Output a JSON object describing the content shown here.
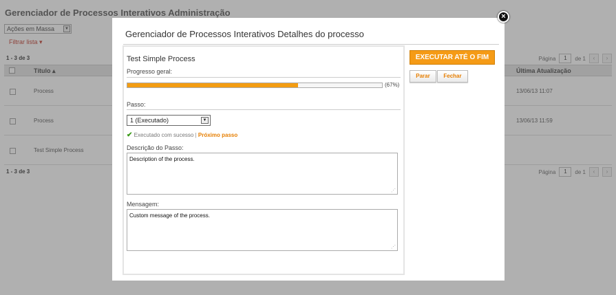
{
  "background": {
    "title": "Gerenciador de Processos Interativos Administração",
    "bulk_actions": "Ações em Massa",
    "filter_link": "Filtrar lista",
    "count_top": "1 - 3 de 3",
    "count_bottom": "1 - 3 de 3",
    "pager": {
      "page_label": "Página",
      "page_value": "1",
      "of_label": "de 1",
      "prev": "‹",
      "next": "›"
    },
    "columns": {
      "title": "Título",
      "updated": "Última Atualização"
    },
    "rows": [
      {
        "name": "Process",
        "updated": "13/06/13 11:07"
      },
      {
        "name": "Process",
        "updated": "13/06/13 11:59"
      },
      {
        "name": "Test Simple Process",
        "updated": ""
      }
    ]
  },
  "modal": {
    "title": "Gerenciador de Processos Interativos Detalhes do processo",
    "close_icon": "close-icon",
    "process_name": "Test Simple Process",
    "progress_label": "Progresso geral:",
    "progress_percent": 67,
    "progress_text": "(67%)",
    "step_label": "Passo:",
    "step_selected": "1 (Executado)",
    "status_text": "Executado com sucesso",
    "status_separator": "|",
    "next_step": "Próximo passo",
    "description_label": "Descrição do Passo:",
    "description_value": "Description of the process.",
    "message_label": "Mensagem:",
    "message_value": "Custom message of the process.",
    "run_to_end": "EXECUTAR ATÉ O FIM",
    "stop": "Parar",
    "close": "Fechar"
  },
  "colors": {
    "accent": "#f59b16",
    "success": "#3a9a18",
    "link": "#e67e00"
  }
}
